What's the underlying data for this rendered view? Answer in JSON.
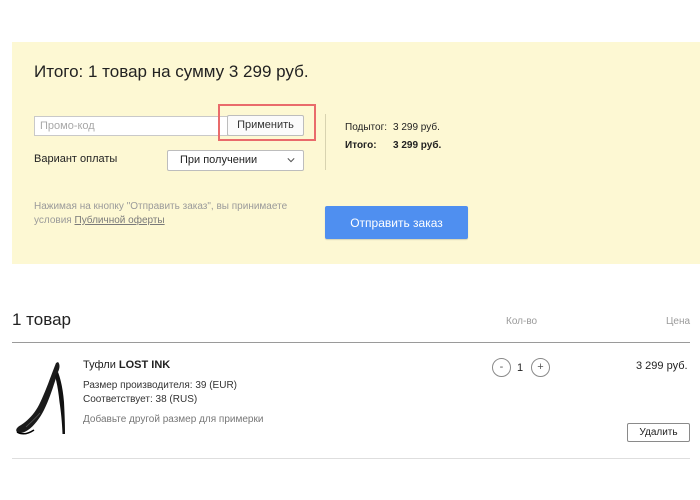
{
  "summary": {
    "title": "Итого: 1 товар на сумму 3 299 руб.",
    "promo_placeholder": "Промо-код",
    "apply_label": "Применить",
    "payment_label": "Вариант оплаты",
    "payment_selected": "При получении",
    "subtotal_label": "Подытог:",
    "subtotal_value": "3 299 руб.",
    "total_label": "Итого:",
    "total_value": "3 299 руб.",
    "legal_text": "Нажимая на кнопку \"Отправить заказ\", вы принимаете условия ",
    "legal_link": "Публичной оферты",
    "submit_label": "Отправить заказ"
  },
  "cart": {
    "title": "1 товар",
    "col_qty": "Кол-во",
    "col_price": "Цена",
    "item": {
      "name_prefix": "Туфли ",
      "name_brand": "LOST INK",
      "size_line": "Размер производителя: 39 (EUR)",
      "match_line": "Соответствует: 38 (RUS)",
      "add_size_link": "Добавьте другой размер для примерки",
      "qty_minus": "-",
      "qty_value": "1",
      "qty_plus": "+",
      "price": "3 299 руб.",
      "remove_label": "Удалить",
      "image_icon": "high-heel-shoe-icon"
    }
  },
  "colors": {
    "summary_bg": "#fdf8d3",
    "accent_button": "#4f8ff0",
    "highlight": "#e96b6b"
  }
}
